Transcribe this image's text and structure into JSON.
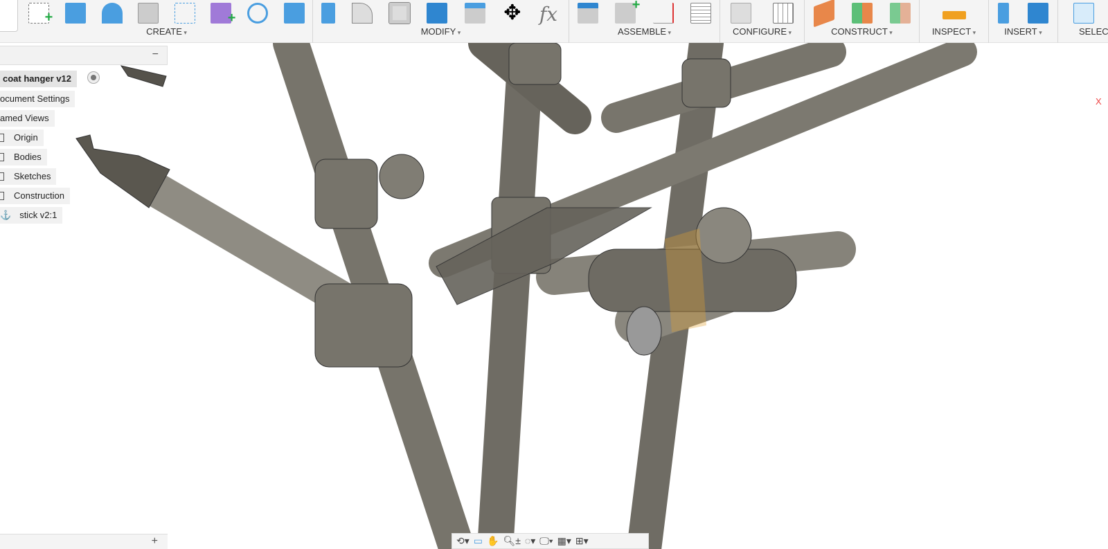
{
  "toolbar": {
    "groups": [
      {
        "label": "CREATE",
        "icons": [
          "create-sketch-icon",
          "extrude-icon",
          "revolve-icon",
          "hole-icon",
          "pattern-icon",
          "create-form-icon",
          "derive-icon",
          "box-icon"
        ]
      },
      {
        "label": "MODIFY",
        "icons": [
          "press-pull-icon",
          "fillet-icon",
          "shell-icon",
          "combine-icon",
          "offset-face-icon",
          "move-icon",
          "parameters-icon"
        ]
      },
      {
        "label": "ASSEMBLE",
        "icons": [
          "joint-icon",
          "new-component-icon",
          "as-built-joint-icon",
          "bom-icon"
        ]
      },
      {
        "label": "CONFIGURE",
        "icons": [
          "configure-icon",
          "configuration-table-icon"
        ]
      },
      {
        "label": "CONSTRUCT",
        "icons": [
          "offset-plane-icon",
          "midplane-icon",
          "plane-through-icon"
        ]
      },
      {
        "label": "INSPECT",
        "icons": [
          "measure-icon"
        ]
      },
      {
        "label": "INSERT",
        "icons": [
          "insert-mcmaster-icon",
          "insert-canvas-icon"
        ]
      },
      {
        "label": "SELEC",
        "icons": [
          "select-icon"
        ]
      }
    ],
    "fx": "fx"
  },
  "browser": {
    "root": "coat hanger v12",
    "items": [
      "ocument Settings",
      "amed Views",
      "Origin",
      "Bodies",
      "Sketches",
      "Construction",
      "stick v2:1"
    ],
    "collapse": "−",
    "add": "+"
  },
  "viewcube": {
    "axis": "X"
  },
  "colors": {
    "tube": "#8a877e",
    "icon_blue": "#4a9ee0",
    "icon_green": "#22aa44",
    "highlight": "#e0a030"
  }
}
